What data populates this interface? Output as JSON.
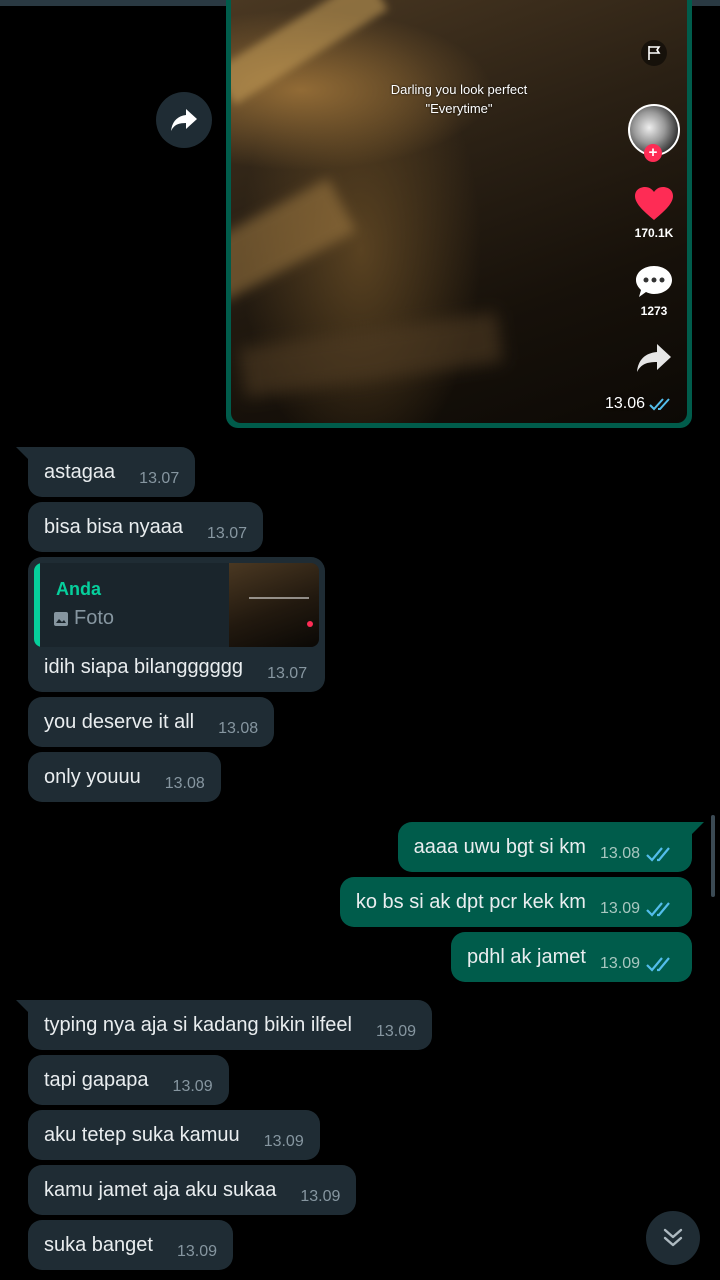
{
  "image_message": {
    "caption_line1": "Darling you look perfect",
    "caption_line2": "\"Everytime\"",
    "like_count": "170.1K",
    "comment_count": "1273",
    "time": "13.06"
  },
  "incoming_group_1": [
    {
      "text": "astagaa",
      "time": "13.07"
    },
    {
      "text": "bisa bisa nyaaa",
      "time": "13.07"
    }
  ],
  "reply_message": {
    "quoted_name": "Anda",
    "quoted_type": "Foto",
    "text": "idih siapa bilangggggg",
    "time": "13.07"
  },
  "incoming_group_1b": [
    {
      "text": "you deserve it all",
      "time": "13.08"
    },
    {
      "text": "only youuu",
      "time": "13.08"
    }
  ],
  "outgoing": [
    {
      "text": "aaaa uwu bgt si km",
      "time": "13.08"
    },
    {
      "text": "ko bs si ak dpt pcr kek km",
      "time": "13.09"
    },
    {
      "text": "pdhl ak jamet",
      "time": "13.09"
    }
  ],
  "incoming_group_2": [
    {
      "text": "typing nya aja si kadang bikin ilfeel",
      "time": "13.09"
    },
    {
      "text": "tapi gapapa",
      "time": "13.09"
    },
    {
      "text": "aku tetep suka kamuu",
      "time": "13.09"
    },
    {
      "text": "kamu jamet aja aku sukaa",
      "time": "13.09"
    },
    {
      "text": "suka banget",
      "time": "13.09"
    }
  ],
  "colors": {
    "incoming_bubble": "#1f2c34",
    "outgoing_bubble": "#005c4b",
    "read_ticks": "#53bdeb",
    "accent": "#06cf9c"
  }
}
